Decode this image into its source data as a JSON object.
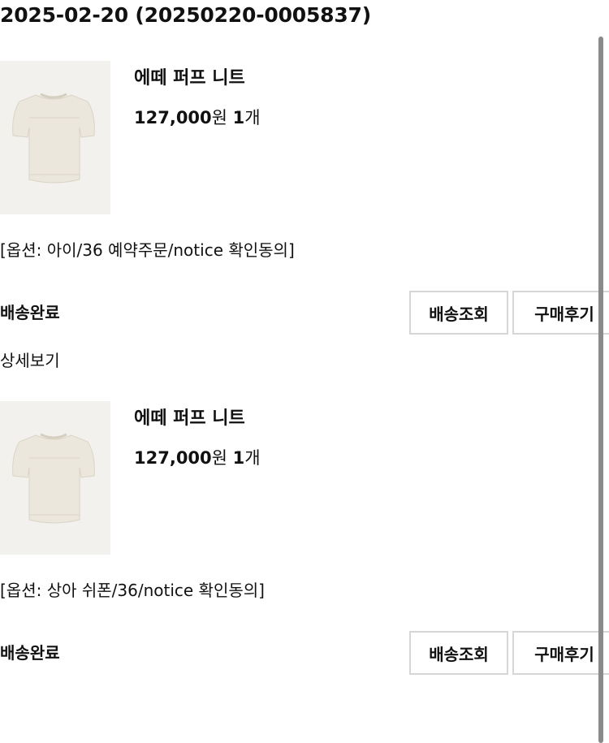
{
  "order": {
    "header": "2025-02-20 (20250220-0005837)",
    "details_link": "상세보기"
  },
  "items": [
    {
      "name": "에떼 퍼프 니트",
      "price": "127,000",
      "price_unit": "원 ",
      "qty": "1",
      "qty_unit": "개",
      "option": "[옵션: 아이/36 예약주문/notice 확인동의]",
      "status": "배송완료",
      "track_button": "배송조회",
      "review_button": "구매후기"
    },
    {
      "name": "에떼 퍼프 니트",
      "price": "127,000",
      "price_unit": "원 ",
      "qty": "1",
      "qty_unit": "개",
      "option": "[옵션: 상아 쉬폰/36/notice 확인동의]",
      "status": "배송완료",
      "track_button": "배송조회",
      "review_button": "구매후기"
    }
  ],
  "colors": {
    "text": "#111111",
    "button_border": "#d6d6d6",
    "thumb_bg": "#f3f1ed",
    "knit_color": "#ebe7dc",
    "scrollbar": "#8a8a8a"
  },
  "icons": {
    "product_image": "ivory-knit-tshirt-image"
  }
}
